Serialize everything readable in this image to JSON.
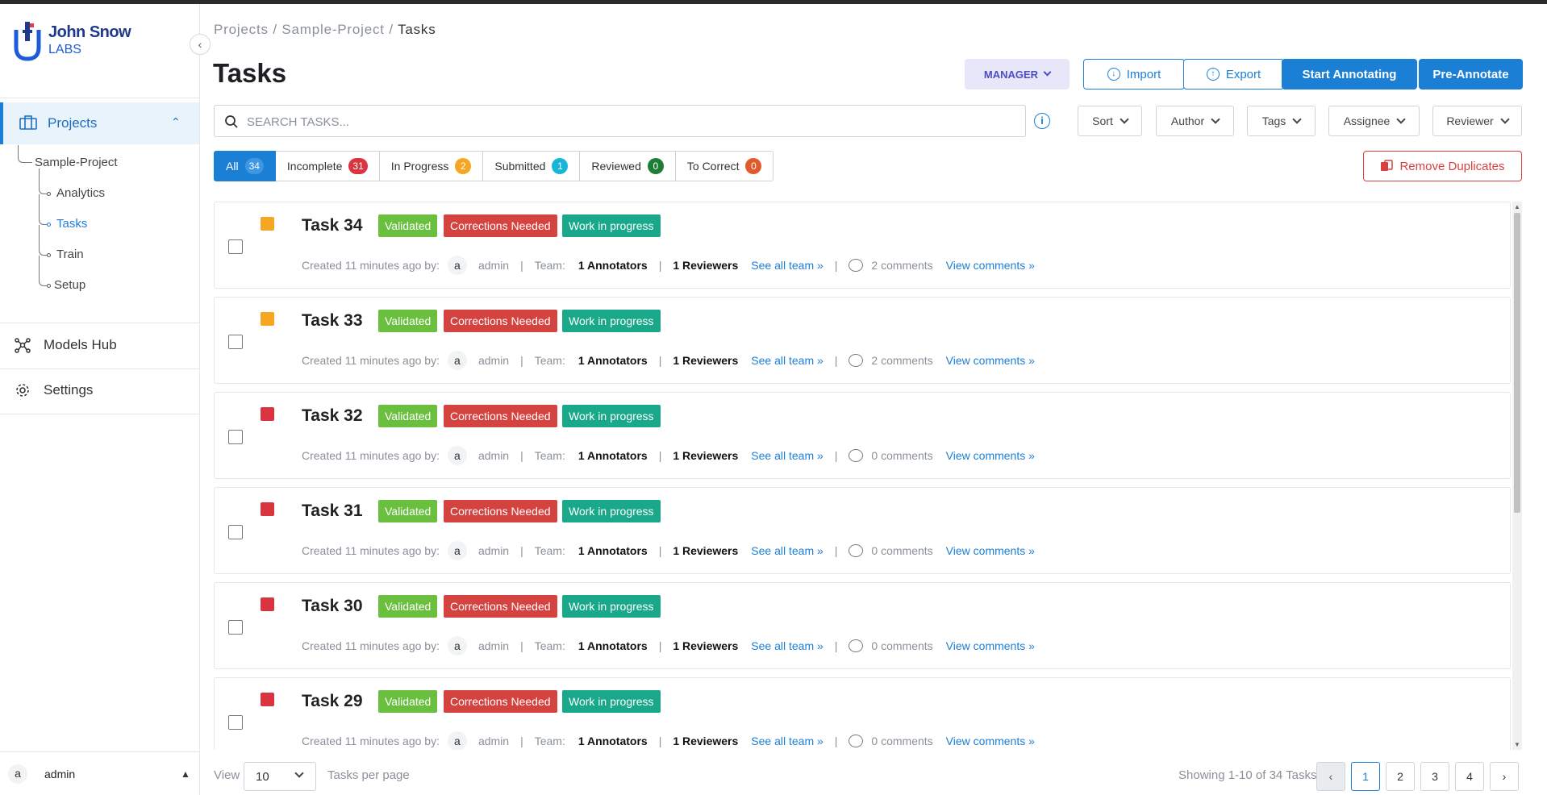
{
  "sidebar": {
    "logo_line1": "John Snow",
    "logo_line2": "LABS",
    "projects_label": "Projects",
    "project_name": "Sample-Project",
    "sub_items": [
      "Analytics",
      "Tasks",
      "Train",
      "Setup"
    ],
    "active_sub": "Tasks",
    "models_hub_label": "Models Hub",
    "settings_label": "Settings",
    "user_initial": "a",
    "user_name": "admin"
  },
  "breadcrumb": {
    "part1": "Projects",
    "part2": "Sample-Project",
    "current": "Tasks"
  },
  "page_title": "Tasks",
  "toolbar": {
    "role_label": "MANAGER",
    "import_label": "Import",
    "export_label": "Export",
    "start_label": "Start Annotating",
    "preannotate_label": "Pre-Annotate"
  },
  "search": {
    "placeholder": "SEARCH TASKS..."
  },
  "filters": [
    "Sort",
    "Author",
    "Tags",
    "Assignee",
    "Reviewer"
  ],
  "tabs": [
    {
      "label": "All",
      "count": "34",
      "color": "#1b7fd6"
    },
    {
      "label": "Incomplete",
      "count": "31",
      "color": "#d9343f"
    },
    {
      "label": "In Progress",
      "count": "2",
      "color": "#f5a623"
    },
    {
      "label": "Submitted",
      "count": "1",
      "color": "#17b6d8"
    },
    {
      "label": "Reviewed",
      "count": "0",
      "color": "#1e7e34"
    },
    {
      "label": "To Correct",
      "count": "0",
      "color": "#e05a2b"
    }
  ],
  "remove_duplicates_label": "Remove Duplicates",
  "tag_labels": {
    "validated": "Validated",
    "corrections": "Corrections Needed",
    "wip": "Work in progress"
  },
  "tag_colors": {
    "validated": "#6bbf3f",
    "corrections": "#d4433f",
    "wip": "#1aa88a"
  },
  "task_meta": {
    "created_prefix": "Created 11 minutes ago by:",
    "author_initial": "a",
    "author": "admin",
    "team_label": "Team:",
    "annotators": "1 Annotators",
    "reviewers": "1 Reviewers",
    "see_team": "See all team »",
    "view_comments": "View comments »"
  },
  "tasks": [
    {
      "title": "Task 34",
      "flag_color": "#f5a623",
      "comments": "2 comments"
    },
    {
      "title": "Task 33",
      "flag_color": "#f5a623",
      "comments": "2 comments"
    },
    {
      "title": "Task 32",
      "flag_color": "#d9343f",
      "comments": "0 comments"
    },
    {
      "title": "Task 31",
      "flag_color": "#d9343f",
      "comments": "0 comments"
    },
    {
      "title": "Task 30",
      "flag_color": "#d9343f",
      "comments": "0 comments"
    },
    {
      "title": "Task 29",
      "flag_color": "#d9343f",
      "comments": "0 comments"
    }
  ],
  "footer": {
    "view_label": "View",
    "per_page_value": "10",
    "per_page_label": "Tasks per page",
    "showing": "Showing 1-10 of 34 Tasks",
    "pages": [
      "1",
      "2",
      "3",
      "4"
    ],
    "current_page": "1",
    "prev_icon": "‹",
    "next_icon": "›"
  }
}
